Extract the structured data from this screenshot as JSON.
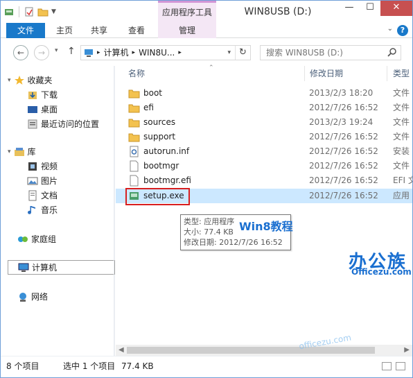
{
  "titlebar": {
    "context_tab_title": "应用程序工具",
    "window_title": "WIN8USB (D:)",
    "minimize": "—",
    "maximize": "☐",
    "close": "✕"
  },
  "ribbon": {
    "tabs": [
      "文件",
      "主页",
      "共享",
      "查看",
      "管理"
    ],
    "help": "?"
  },
  "address": {
    "path": [
      "计算机",
      "WIN8U..."
    ],
    "search_placeholder": "搜索 WIN8USB (D:)"
  },
  "nav": {
    "favorites": "收藏夹",
    "downloads": "下载",
    "desktop": "桌面",
    "recent": "最近访问的位置",
    "libraries": "库",
    "videos": "视频",
    "pictures": "图片",
    "documents": "文档",
    "music": "音乐",
    "homegroup": "家庭组",
    "computer": "计算机",
    "network": "网络"
  },
  "columns": {
    "name": "名称",
    "date": "修改日期",
    "type": "类型"
  },
  "files": [
    {
      "name": "boot",
      "date": "2013/2/3 18:20",
      "type": "文件"
    },
    {
      "name": "efi",
      "date": "2012/7/26 16:52",
      "type": "文件"
    },
    {
      "name": "sources",
      "date": "2013/2/3 19:24",
      "type": "文件"
    },
    {
      "name": "support",
      "date": "2012/7/26 16:52",
      "type": "文件"
    },
    {
      "name": "autorun.inf",
      "date": "2012/7/26 16:52",
      "type": "安装"
    },
    {
      "name": "bootmgr",
      "date": "2012/7/26 16:52",
      "type": "文件"
    },
    {
      "name": "bootmgr.efi",
      "date": "2012/7/26 16:52",
      "type": "EFI 文"
    },
    {
      "name": "setup.exe",
      "date": "2012/7/26 16:52",
      "type": "应用"
    }
  ],
  "tooltip": {
    "type_line": "类型: 应用程序",
    "size_line": "大小: 77.4 KB",
    "date_line": "修改日期: 2012/7/26 16:52"
  },
  "watermark": {
    "brand": "办公族",
    "site": "Officezu.com",
    "sub": "Win8教程",
    "corner": "officezu.com"
  },
  "status": {
    "item_count": "8 个项目",
    "selected": "选中 1 个项目",
    "size": "77.4 KB"
  }
}
